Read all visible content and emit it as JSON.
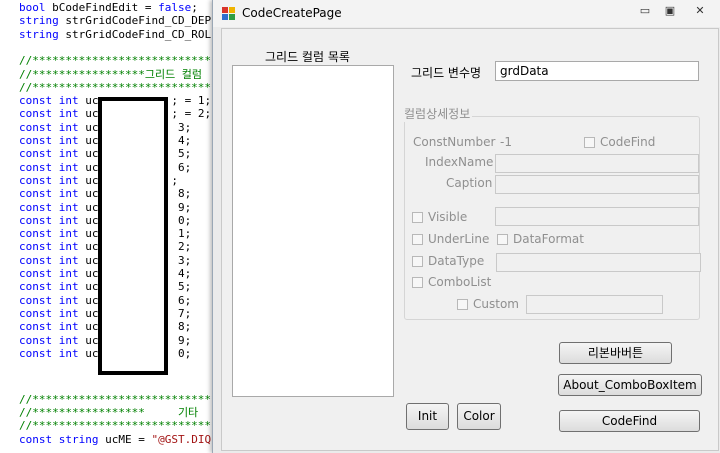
{
  "code": {
    "lines": [
      {
        "parts": [
          {
            "c": "kw",
            "t": "bool"
          },
          {
            "c": "tx",
            "t": " bCodeFindEdit = "
          },
          {
            "c": "kw",
            "t": "false"
          },
          {
            "c": "tx",
            "t": ";"
          }
        ]
      },
      {
        "parts": [
          {
            "c": "kw",
            "t": "string"
          },
          {
            "c": "tx",
            "t": " strGridCodeFind_CD_DEP"
          }
        ]
      },
      {
        "parts": [
          {
            "c": "kw",
            "t": "string"
          },
          {
            "c": "tx",
            "t": " strGridCodeFind_CD_ROL"
          }
        ]
      },
      {
        "parts": []
      },
      {
        "parts": [
          {
            "c": "cm",
            "t": "//****************************"
          }
        ]
      },
      {
        "parts": [
          {
            "c": "cm",
            "t": "//*****************그리드 컬럼"
          }
        ]
      },
      {
        "parts": [
          {
            "c": "cm",
            "t": "//****************************"
          }
        ]
      },
      {
        "parts": [
          {
            "c": "kw",
            "t": "const int"
          },
          {
            "c": "tx",
            "t": " uc           ; = 1;"
          }
        ]
      },
      {
        "parts": [
          {
            "c": "kw",
            "t": "const int"
          },
          {
            "c": "tx",
            "t": " uc           ; = 2;"
          }
        ]
      },
      {
        "parts": [
          {
            "c": "kw",
            "t": "const int"
          },
          {
            "c": "tx",
            "t": " uc            3;"
          }
        ]
      },
      {
        "parts": [
          {
            "c": "kw",
            "t": "const int"
          },
          {
            "c": "tx",
            "t": " uc            4;"
          }
        ]
      },
      {
        "parts": [
          {
            "c": "kw",
            "t": "const int"
          },
          {
            "c": "tx",
            "t": " uc            5;"
          }
        ]
      },
      {
        "parts": [
          {
            "c": "kw",
            "t": "const int"
          },
          {
            "c": "tx",
            "t": " uc            6;"
          }
        ]
      },
      {
        "parts": [
          {
            "c": "kw",
            "t": "const int"
          },
          {
            "c": "tx",
            "t": " uc           ;"
          }
        ]
      },
      {
        "parts": [
          {
            "c": "kw",
            "t": "const int"
          },
          {
            "c": "tx",
            "t": " uc            8;"
          }
        ]
      },
      {
        "parts": [
          {
            "c": "kw",
            "t": "const int"
          },
          {
            "c": "tx",
            "t": " uc            9;"
          }
        ]
      },
      {
        "parts": [
          {
            "c": "kw",
            "t": "const int"
          },
          {
            "c": "tx",
            "t": " uc            0;"
          }
        ]
      },
      {
        "parts": [
          {
            "c": "kw",
            "t": "const int"
          },
          {
            "c": "tx",
            "t": " uc            1;"
          }
        ]
      },
      {
        "parts": [
          {
            "c": "kw",
            "t": "const int"
          },
          {
            "c": "tx",
            "t": " uc            2;"
          }
        ]
      },
      {
        "parts": [
          {
            "c": "kw",
            "t": "const int"
          },
          {
            "c": "tx",
            "t": " uc            3;"
          }
        ]
      },
      {
        "parts": [
          {
            "c": "kw",
            "t": "const int"
          },
          {
            "c": "tx",
            "t": " uc            4;"
          }
        ]
      },
      {
        "parts": [
          {
            "c": "kw",
            "t": "const int"
          },
          {
            "c": "tx",
            "t": " uc            5;"
          }
        ]
      },
      {
        "parts": [
          {
            "c": "kw",
            "t": "const int"
          },
          {
            "c": "tx",
            "t": " uc            6;"
          }
        ]
      },
      {
        "parts": [
          {
            "c": "kw",
            "t": "const int"
          },
          {
            "c": "tx",
            "t": " uc            7;"
          }
        ]
      },
      {
        "parts": [
          {
            "c": "kw",
            "t": "const int"
          },
          {
            "c": "tx",
            "t": " uc            8;"
          }
        ]
      },
      {
        "parts": [
          {
            "c": "kw",
            "t": "const int"
          },
          {
            "c": "tx",
            "t": " uc            9;"
          }
        ]
      },
      {
        "parts": [
          {
            "c": "kw",
            "t": "const int"
          },
          {
            "c": "tx",
            "t": " uc            0;"
          }
        ]
      },
      {
        "parts": []
      },
      {
        "parts": []
      },
      {
        "parts": [
          {
            "c": "cm",
            "t": "//****************************"
          }
        ]
      },
      {
        "parts": [
          {
            "c": "cm",
            "t": "//*****************     기타"
          }
        ]
      },
      {
        "parts": [
          {
            "c": "cm",
            "t": "//****************************"
          }
        ]
      },
      {
        "parts": [
          {
            "c": "kw",
            "t": "const string"
          },
          {
            "c": "tx",
            "t": " ucME = "
          },
          {
            "c": "str",
            "t": "\"@GST.DIQ"
          }
        ]
      }
    ]
  },
  "window": {
    "title": "CodeCreatePage",
    "min_glyph": "▭",
    "max_glyph": "▣",
    "close_glyph": "✕",
    "icon_colors": [
      "#d9342b",
      "#f0b400",
      "#2f6fd0",
      "#2f9e44"
    ]
  },
  "form": {
    "grid_column_list_label": "그리드 컬럼 목록",
    "grid_var_label": "그리드 변수명",
    "grid_var_value": "grdData",
    "group_title": "컬럼상세정보",
    "const_number_label": "ConstNumber",
    "const_number_value": "-1",
    "codefind_check_label": "CodeFind",
    "indexname_label": "IndexName",
    "caption_label": "Caption",
    "visible_label": "Visible",
    "underline_label": "UnderLine",
    "dataformat_label": "DataFormat",
    "datatype_label": "DataType",
    "combolist_label": "ComboList",
    "custom_label": "Custom"
  },
  "buttons": {
    "ribbon": "리본바버튼",
    "about_combo": "About_ComboBoxItem",
    "codefind": "CodeFind",
    "init": "Init",
    "color": "Color"
  }
}
